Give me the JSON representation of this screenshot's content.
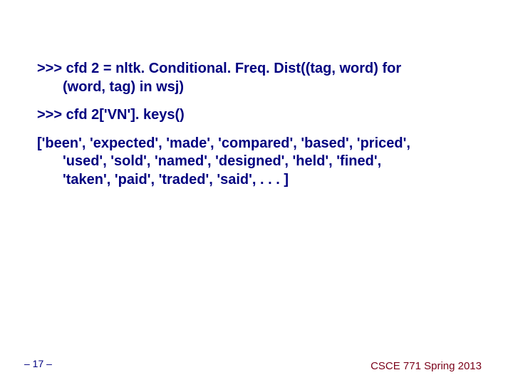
{
  "code": {
    "line1a": ">>> cfd 2 = nltk. Conditional. Freq. Dist((tag, word) for",
    "line1b": "(word, tag) in wsj)",
    "line2": ">>> cfd 2['VN']. keys()",
    "line3a": "['been', 'expected', 'made', 'compared', 'based', 'priced',",
    "line3b": "'used', 'sold', 'named', 'designed', 'held', 'fined',",
    "line3c": "'taken', 'paid', 'traded', 'said', . . . ]"
  },
  "footer": {
    "page": "– 17 –",
    "course": "CSCE 771 Spring 2013"
  }
}
